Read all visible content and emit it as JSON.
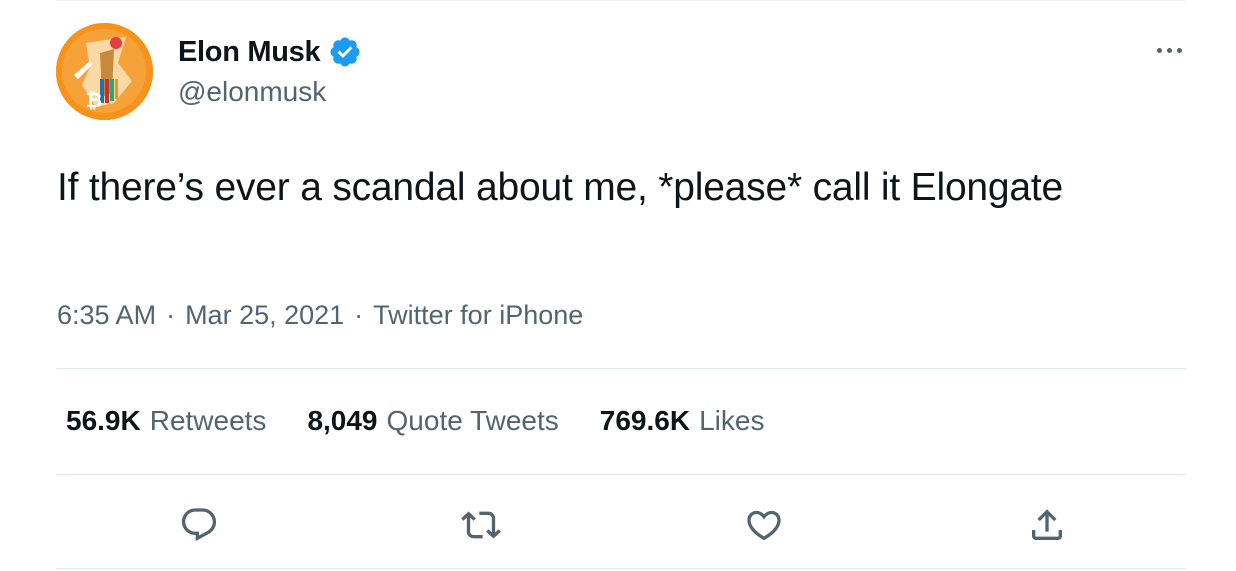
{
  "tweet": {
    "author": {
      "display_name": "Elon Musk",
      "handle": "@elonmusk",
      "verified": true
    },
    "text": "If there’s ever a scandal about me, *please* call it Elongate",
    "meta": {
      "time": "6:35 AM",
      "separator": "·",
      "date": "Mar 25, 2021",
      "source": "Twitter for iPhone"
    },
    "stats": [
      {
        "value": "56.9K",
        "label": "Retweets"
      },
      {
        "value": "8,049",
        "label": "Quote Tweets"
      },
      {
        "value": "769.6K",
        "label": "Likes"
      }
    ],
    "actions": [
      {
        "icon": "reply-icon"
      },
      {
        "icon": "retweet-icon"
      },
      {
        "icon": "like-heart-icon"
      },
      {
        "icon": "share-icon"
      }
    ]
  },
  "colors": {
    "text_primary": "#0f1419",
    "text_secondary": "#536471",
    "verified_blue": "#1d9bf0",
    "divider": "#e1e8ed",
    "avatar_bg": "#f7931a"
  }
}
